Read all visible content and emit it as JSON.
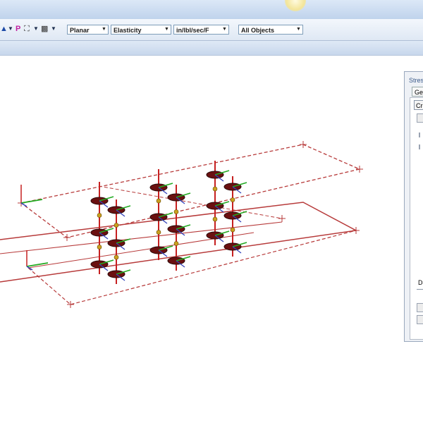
{
  "toolbar": {
    "view_mode": "Planar",
    "analysis_type": "Elasticity",
    "units": "in/lbl/sec/F",
    "object_filter": "All Objects",
    "icons": [
      "select-icon",
      "dropdown-arrow-icon",
      "p-marker-icon",
      "tool-icon",
      "dropdown-arrow-icon",
      "probe-icon",
      "dropdown-arrow-icon"
    ]
  },
  "panel": {
    "title": "Stress",
    "tab_label": "Gen",
    "create_button": "Cre",
    "data_label": "Da"
  },
  "colors": {
    "frame_red": "#b73a3a",
    "column_red": "#c62020",
    "axis_green": "#22aa22",
    "axis_blue": "#3344bb",
    "node_gold": "#c9a020",
    "disc_dark": "#6a1010"
  }
}
